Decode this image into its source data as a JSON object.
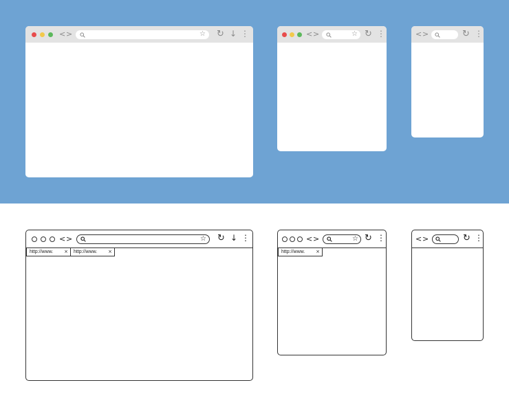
{
  "colors": {
    "band": "#6ea3d3",
    "close_dot": "#e84c4c",
    "minimize_dot": "#f2c94c",
    "maximize_dot": "#5cb85c",
    "toolbar": "#e3e3e3",
    "outline": "#333333"
  },
  "icons": {
    "back": "<",
    "forward": ">",
    "search": "search-icon",
    "bookmark": "☆",
    "reload": "↻",
    "download": "↓",
    "menu": "⋮",
    "close_tab": "×"
  },
  "tabs": {
    "desktop": [
      {
        "label": "http://www.",
        "close": "×"
      },
      {
        "label": "http://www.",
        "close": "×"
      }
    ],
    "tablet": [
      {
        "label": "http://www.",
        "close": "×"
      }
    ]
  }
}
